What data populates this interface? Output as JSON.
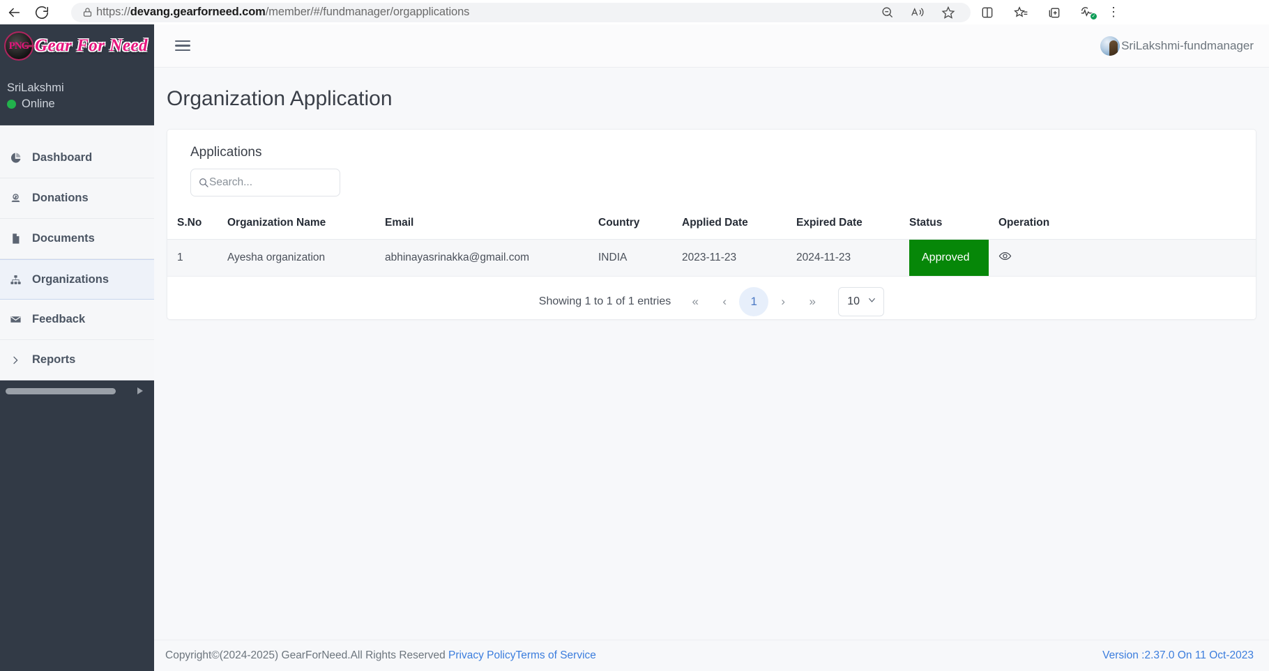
{
  "browser": {
    "back_icon": "arrow-left-icon",
    "reload_icon": "reload-icon",
    "lock_icon": "lock-icon",
    "url_prefix": "https://",
    "url_domain": "devang.gearforneed.com",
    "url_path": "/member/#/fundmanager/orgapplications",
    "icons": [
      "zoom-out-icon",
      "read-aloud-icon",
      "favorite-star-icon",
      "split-screen-icon",
      "favorites-list-icon",
      "collections-icon",
      "browser-essentials-icon",
      "settings-more-icon"
    ]
  },
  "sidebar": {
    "logo_mark": "PNG",
    "logo_text": "Gear For Need",
    "user_name": "SriLakshmi",
    "status_label": "Online",
    "status_color": "#22b24c",
    "items": [
      {
        "label": "Dashboard",
        "icon": "pie-chart-icon",
        "active": false
      },
      {
        "label": "Donations",
        "icon": "donation-icon",
        "active": false
      },
      {
        "label": "Documents",
        "icon": "document-icon",
        "active": false
      },
      {
        "label": "Organizations",
        "icon": "sitemap-icon",
        "active": true
      },
      {
        "label": "Feedback",
        "icon": "envelope-icon",
        "active": false
      },
      {
        "label": "Reports",
        "icon": "chevron-right-icon",
        "active": false
      }
    ]
  },
  "topbar": {
    "menu_toggle_icon": "hamburger-icon",
    "avatar_icon": "user-avatar",
    "username": "SriLakshmi-fundmanager"
  },
  "main": {
    "page_title": "Organization Application",
    "card_title": "Applications",
    "search": {
      "value": "",
      "placeholder": "Search..."
    },
    "table": {
      "columns": [
        "S.No",
        "Organization Name",
        "Email",
        "Country",
        "Applied Date",
        "Expired Date",
        "Status",
        "Operation"
      ],
      "rows": [
        {
          "sno": "1",
          "organization_name": "Ayesha organization",
          "email": "abhinayasrinakka@gmail.com",
          "country": "INDIA",
          "applied_date": "2023-11-23",
          "expired_date": "2024-11-23",
          "status": "Approved",
          "status_color": "#068708",
          "operation_icon": "eye-icon"
        }
      ]
    },
    "pagination": {
      "showing": "Showing 1 to 1 of 1 entries",
      "first": "«",
      "prev": "‹",
      "current_page": "1",
      "next": "›",
      "last": "»",
      "page_size": "10"
    }
  },
  "footer": {
    "copyright": "Copyright©(2024-2025) GearForNeed.All Rights Reserved ",
    "privacy_link": "Privacy Policy",
    "terms_link": "Terms of Service",
    "version": "Version :2.37.0 On 11 Oct-2023"
  }
}
